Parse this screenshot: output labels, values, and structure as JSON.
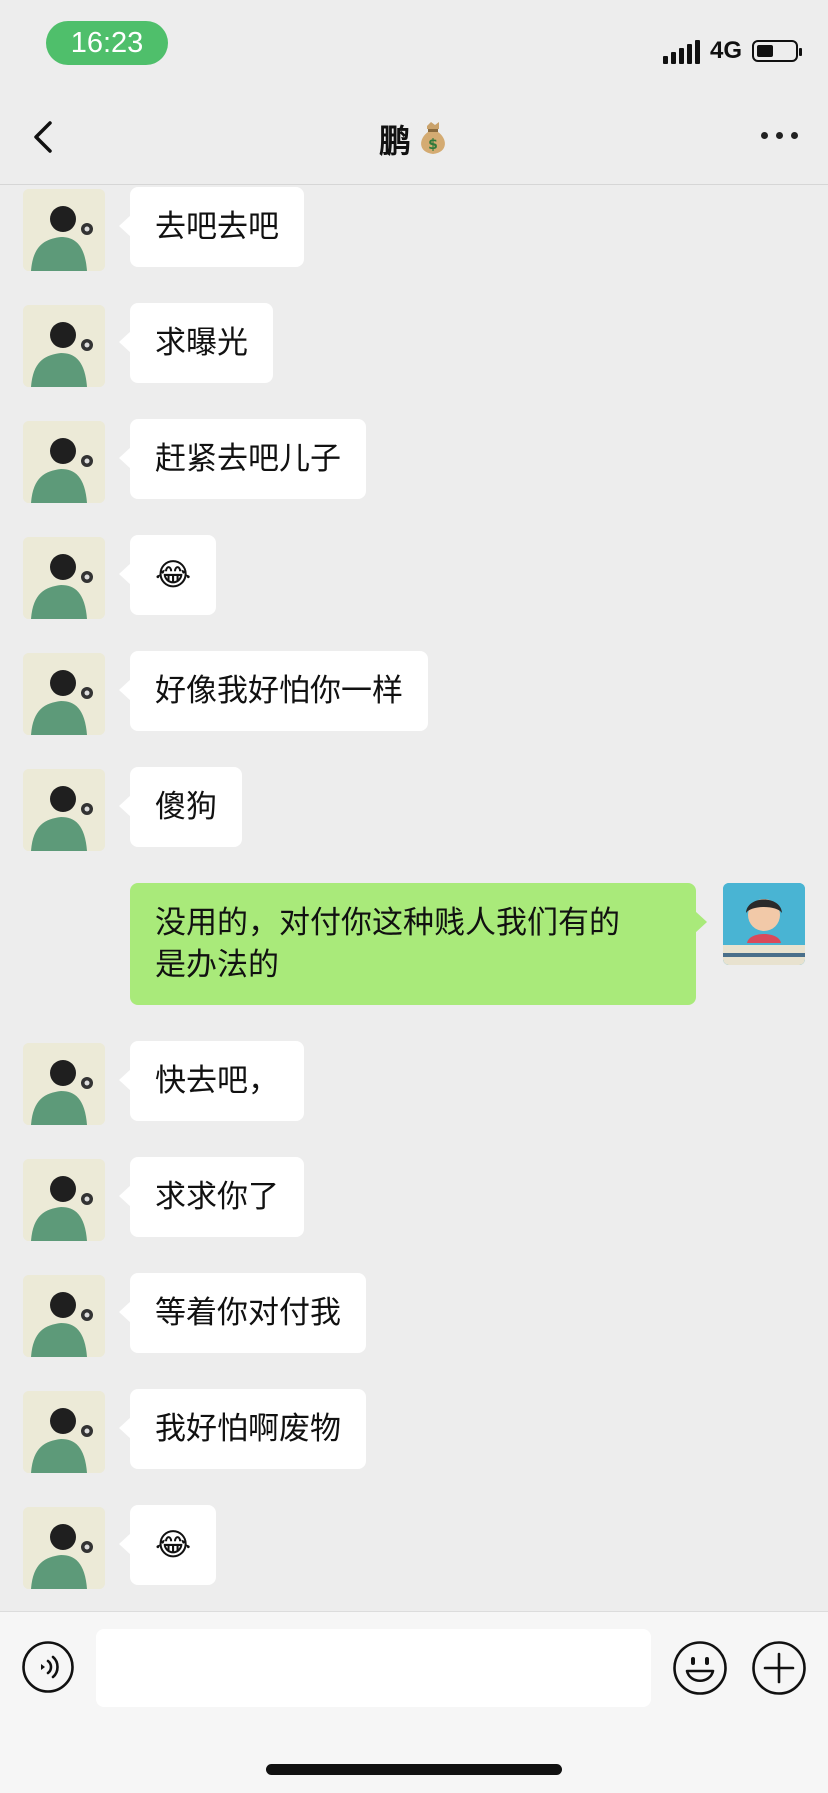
{
  "status_bar": {
    "time": "16:23",
    "network": "4G",
    "battery_level": 0.45
  },
  "header": {
    "title": "鹏",
    "title_icon": "money-bag-icon",
    "back_icon": "chevron-left-icon",
    "more_icon": "more-icon"
  },
  "messages": [
    {
      "side": "left",
      "text": "去吧去吧"
    },
    {
      "side": "left",
      "text": "求曝光"
    },
    {
      "side": "left",
      "text": "赶紧去吧儿子"
    },
    {
      "side": "left",
      "text": "😂",
      "emoji": "tears-of-joy"
    },
    {
      "side": "left",
      "text": "好像我好怕你一样"
    },
    {
      "side": "left",
      "text": "傻狗"
    },
    {
      "side": "right",
      "text_line1": "没用的，对付你这种贱人我们有的",
      "text_line2": "是办法的"
    },
    {
      "side": "left",
      "text": "快去吧，"
    },
    {
      "side": "left",
      "text": "求求你了"
    },
    {
      "side": "left",
      "text": "等着你对付我"
    },
    {
      "side": "left",
      "text": "我好怕啊废物"
    },
    {
      "side": "left",
      "text": "😂",
      "emoji": "tears-of-joy"
    }
  ],
  "input_bar": {
    "voice_icon": "voice-icon",
    "input_value": "",
    "emoji_icon": "smiley-icon",
    "add_icon": "plus-circle-icon"
  },
  "colors": {
    "background": "#ededed",
    "received_bubble": "#ffffff",
    "sent_bubble": "#a9ea7a",
    "time_pill": "#4fbf6b"
  }
}
